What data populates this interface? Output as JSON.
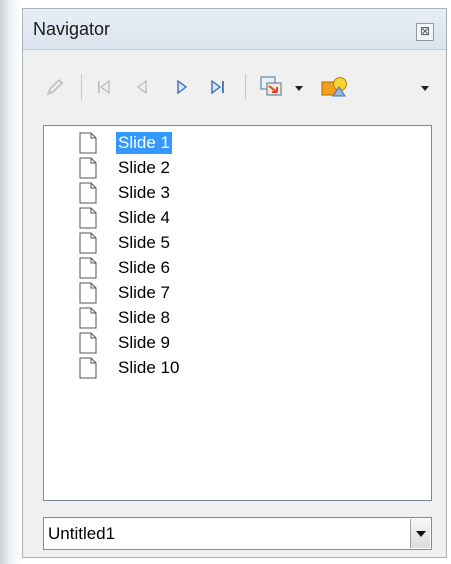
{
  "window": {
    "title": "Navigator",
    "close_glyph": "⊠"
  },
  "toolbar": {
    "buttons": [
      {
        "name": "pencil-icon",
        "label": "Pen"
      },
      {
        "name": "first-slide-icon",
        "label": "First Slide"
      },
      {
        "name": "previous-slide-icon",
        "label": "Previous Slide"
      },
      {
        "name": "next-slide-icon",
        "label": "Next Slide"
      },
      {
        "name": "last-slide-icon",
        "label": "Last Slide"
      },
      {
        "name": "drag-mode-icon",
        "label": "Drag Mode"
      },
      {
        "name": "shapes-icon",
        "label": "Shapes"
      }
    ]
  },
  "tree": {
    "items": [
      {
        "label": "Slide 1",
        "selected": true
      },
      {
        "label": "Slide 2"
      },
      {
        "label": "Slide 3"
      },
      {
        "label": "Slide 4"
      },
      {
        "label": "Slide 5"
      },
      {
        "label": "Slide 6"
      },
      {
        "label": "Slide 7"
      },
      {
        "label": "Slide 8"
      },
      {
        "label": "Slide 9"
      },
      {
        "label": "Slide 10"
      }
    ]
  },
  "document_select": {
    "value": "Untitled1"
  },
  "colors": {
    "selection": "#3399ff",
    "nav_arrow": "#3b6fb6",
    "shape_orange": "#f5a01a",
    "shape_yellow": "#f7d23a",
    "drag_red": "#e0452b"
  }
}
